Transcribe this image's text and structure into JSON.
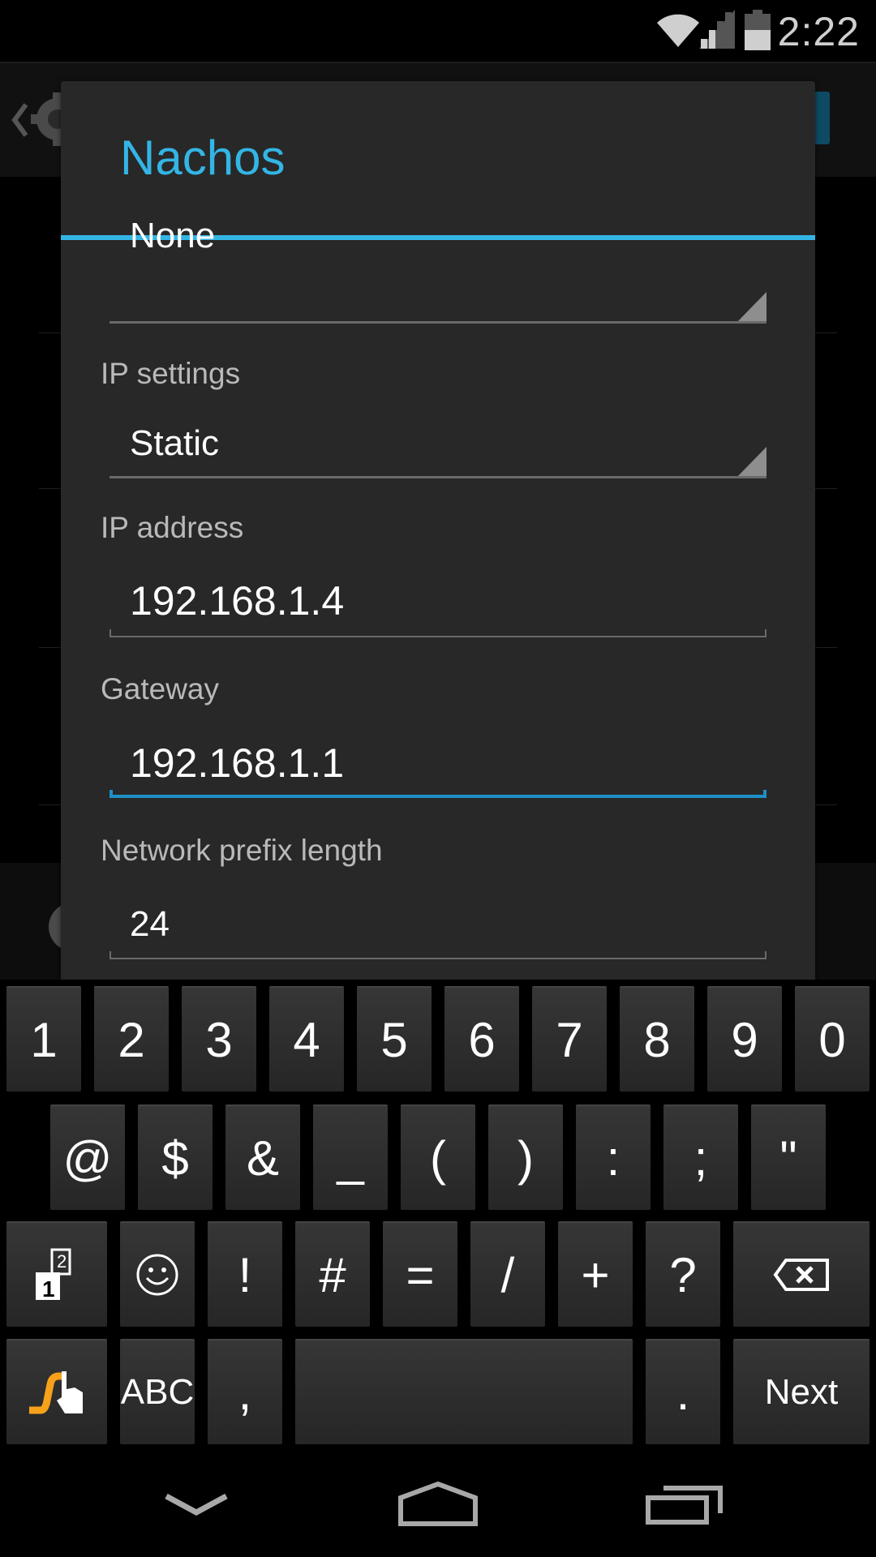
{
  "status_bar": {
    "time": "2:22",
    "icons": [
      "wifi-icon",
      "cell-signal-icon",
      "battery-icon"
    ],
    "signal_bars_lit": 2,
    "signal_bars_total": 4,
    "battery_level": 0.5
  },
  "background_app": {
    "icons": [
      "back-caret-icon",
      "settings-gear-icon"
    ],
    "toggle_color": "#0f4a63"
  },
  "dialog": {
    "title": "Nachos",
    "accent_color": "#33b5e5",
    "fields": [
      {
        "type": "spinner",
        "label": "",
        "value": "None"
      },
      {
        "type": "spinner",
        "label": "IP settings",
        "value": "Static"
      },
      {
        "type": "text",
        "label": "IP address",
        "value": "192.168.1.4",
        "focused": false
      },
      {
        "type": "text",
        "label": "Gateway",
        "value": "192.168.1.1",
        "focused": true
      },
      {
        "type": "text",
        "label": "Network prefix length",
        "value": "24",
        "focused": false
      }
    ]
  },
  "keyboard": {
    "row1": [
      "1",
      "2",
      "3",
      "4",
      "5",
      "6",
      "7",
      "8",
      "9",
      "0"
    ],
    "row2": [
      "@",
      "$",
      "&",
      "_",
      "(",
      ")",
      ":",
      ";",
      "\""
    ],
    "row3": [
      "more-symbols-icon",
      "emoji-icon",
      "!",
      "#",
      "=",
      "/",
      "+",
      "?",
      "backspace-icon"
    ],
    "row4": [
      "swype-icon",
      "ABC",
      ",",
      "space",
      ".",
      "Next"
    ],
    "swype_color": "#f7a11a"
  },
  "nav_bar": {
    "buttons": [
      "back-chevron-icon",
      "home-icon",
      "recents-icon"
    ]
  }
}
